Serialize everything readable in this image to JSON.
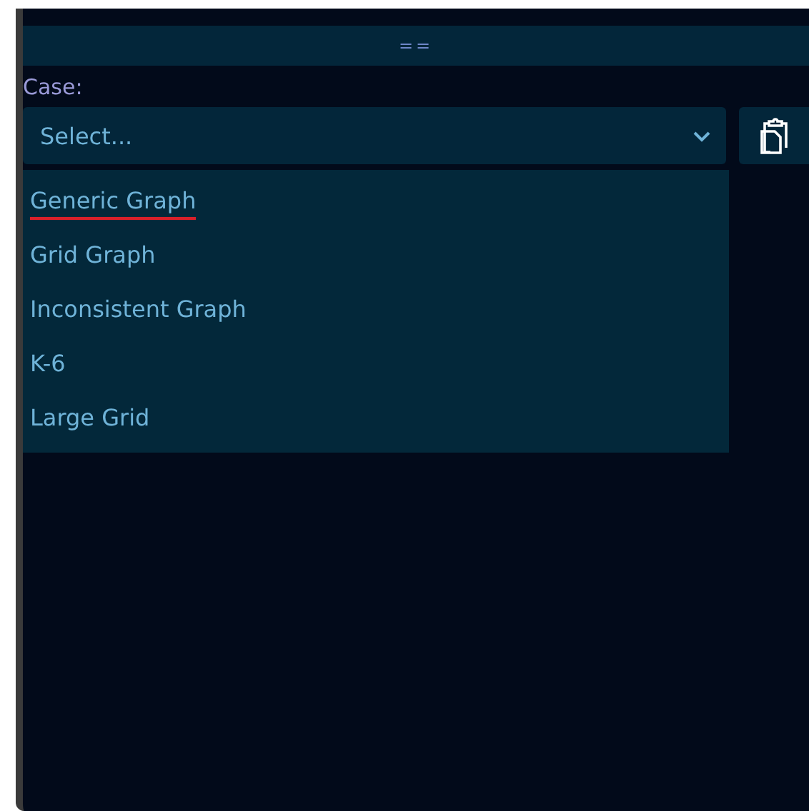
{
  "handle": {
    "label": "=="
  },
  "case_field": {
    "label": "Case:",
    "placeholder": "Select...",
    "expanded": true
  },
  "options": [
    {
      "label": "Generic Graph",
      "marked": true
    },
    {
      "label": "Grid Graph",
      "marked": false
    },
    {
      "label": "Inconsistent Graph",
      "marked": false
    },
    {
      "label": "K-6",
      "marked": false
    },
    {
      "label": "Large Grid",
      "marked": false
    }
  ]
}
